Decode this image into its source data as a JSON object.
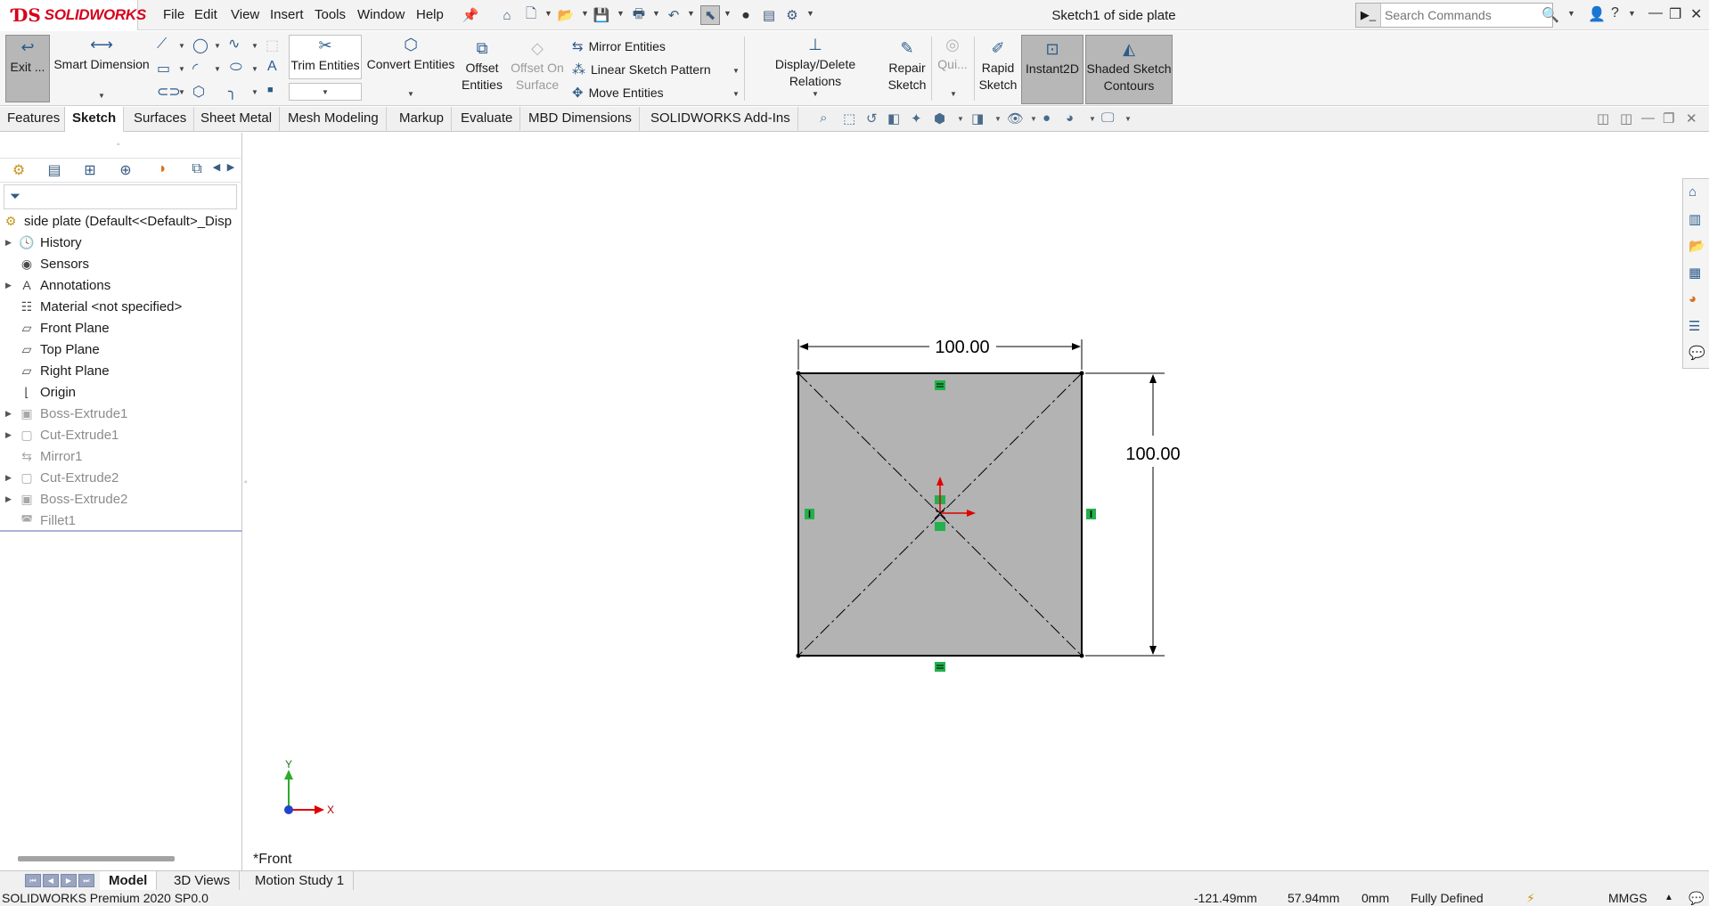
{
  "app": {
    "logo_text": "SOLIDWORKS",
    "document_title": "Sketch1 of side plate",
    "menus": [
      "File",
      "Edit",
      "View",
      "Insert",
      "Tools",
      "Window",
      "Help"
    ]
  },
  "search": {
    "placeholder": "Search Commands"
  },
  "ribbon": {
    "exit_sketch": "Exit ...",
    "smart_dimension": "Smart Dimension",
    "trim_entities": "Trim Entities",
    "convert_entities": "Convert Entities",
    "offset_entities_1": "Offset",
    "offset_entities_2": "Entities",
    "offset_on_surface_1": "Offset On",
    "offset_on_surface_2": "Surface",
    "mirror_entities": "Mirror Entities",
    "linear_sketch_pattern": "Linear Sketch Pattern",
    "move_entities": "Move Entities",
    "display_delete_relations": "Display/Delete Relations",
    "repair_sketch_1": "Repair",
    "repair_sketch_2": "Sketch",
    "quick_snaps": "Qui...",
    "rapid_sketch_1": "Rapid",
    "rapid_sketch_2": "Sketch",
    "instant2d": "Instant2D",
    "shaded_contours_1": "Shaded Sketch",
    "shaded_contours_2": "Contours"
  },
  "tabs": [
    "Features",
    "Sketch",
    "Surfaces",
    "Sheet Metal",
    "Mesh Modeling",
    "Markup",
    "Evaluate",
    "MBD Dimensions",
    "SOLIDWORKS Add-Ins"
  ],
  "active_tab": "Sketch",
  "feature_tree": {
    "root": "side plate  (Default<<Default>_Disp",
    "items": [
      {
        "label": "History",
        "icon": "history-icon",
        "expandable": true,
        "suppressed": false
      },
      {
        "label": "Sensors",
        "icon": "sensor-icon",
        "expandable": false,
        "suppressed": false
      },
      {
        "label": "Annotations",
        "icon": "annotations-icon",
        "expandable": true,
        "suppressed": false
      },
      {
        "label": "Material <not specified>",
        "icon": "material-icon",
        "expandable": false,
        "suppressed": false
      },
      {
        "label": "Front Plane",
        "icon": "plane-icon",
        "expandable": false,
        "suppressed": false
      },
      {
        "label": "Top Plane",
        "icon": "plane-icon",
        "expandable": false,
        "suppressed": false
      },
      {
        "label": "Right Plane",
        "icon": "plane-icon",
        "expandable": false,
        "suppressed": false
      },
      {
        "label": "Origin",
        "icon": "origin-icon",
        "expandable": false,
        "suppressed": false
      },
      {
        "label": "Boss-Extrude1",
        "icon": "extrude-icon",
        "expandable": true,
        "suppressed": true
      },
      {
        "label": "Cut-Extrude1",
        "icon": "cut-extrude-icon",
        "expandable": true,
        "suppressed": true
      },
      {
        "label": "Mirror1",
        "icon": "mirror-icon",
        "expandable": false,
        "suppressed": true
      },
      {
        "label": "Cut-Extrude2",
        "icon": "cut-extrude-icon",
        "expandable": true,
        "suppressed": true
      },
      {
        "label": "Boss-Extrude2",
        "icon": "extrude-icon",
        "expandable": true,
        "suppressed": true
      },
      {
        "label": "Fillet1",
        "icon": "fillet-icon",
        "expandable": false,
        "suppressed": true
      }
    ]
  },
  "sketch": {
    "width_dimension": "100.00",
    "height_dimension": "100.00",
    "fill_color": "#b3b3b3",
    "relation_color": "#22b14c"
  },
  "triad": {
    "x_label": "X",
    "y_label": "Y"
  },
  "view_label": "*Front",
  "bottom_tabs": [
    "Model",
    "3D Views",
    "Motion Study 1"
  ],
  "active_bottom_tab": "Model",
  "status": {
    "product": "SOLIDWORKS Premium 2020 SP0.0",
    "x_coord": "-121.49mm",
    "y_coord": "57.94mm",
    "z_coord": "0mm",
    "sketch_state": "Fully Defined",
    "units": "MMGS"
  }
}
